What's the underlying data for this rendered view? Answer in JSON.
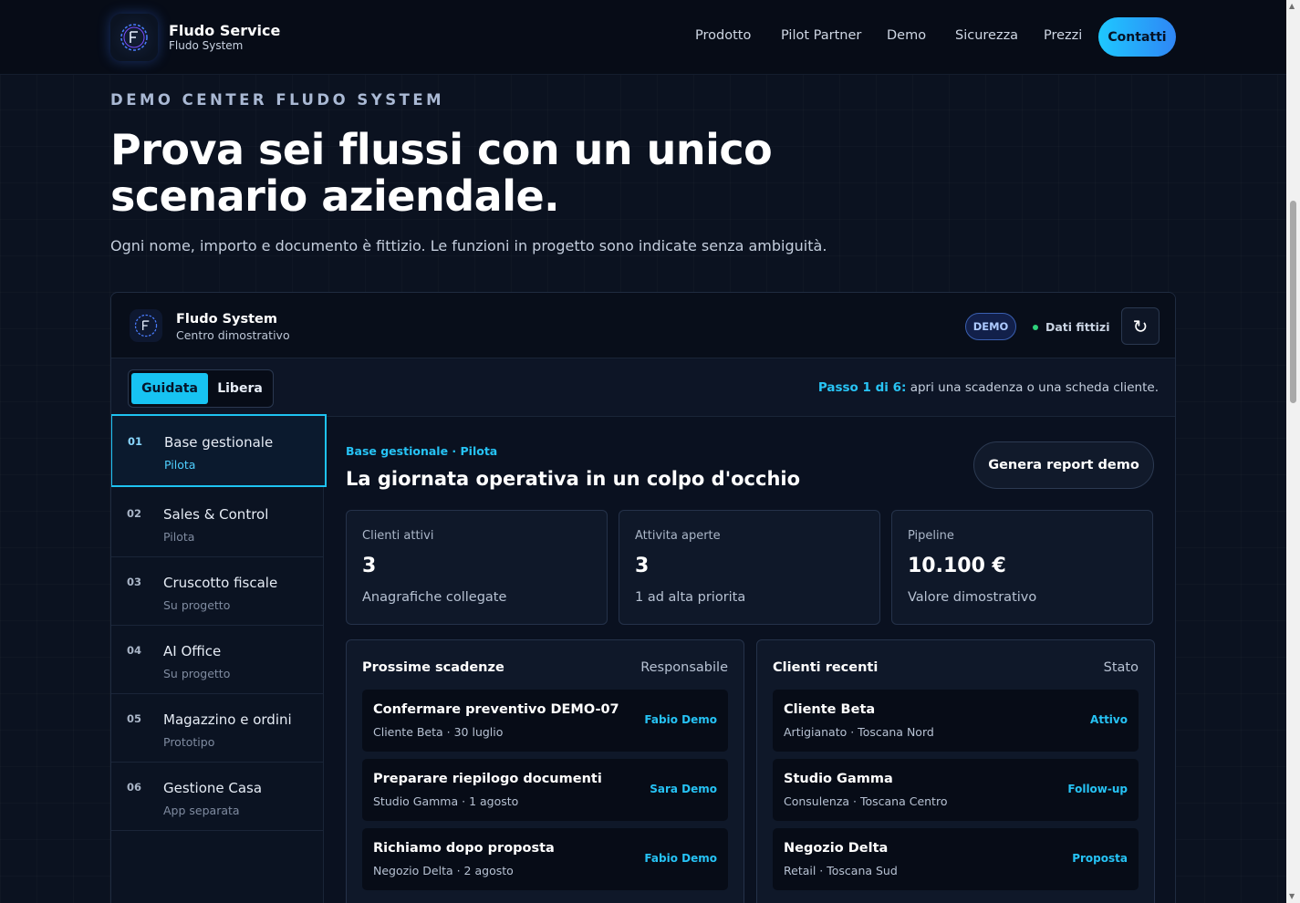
{
  "header": {
    "brand_title": "Fludo Service",
    "brand_sub": "Fludo System",
    "nav": [
      "Prodotto",
      "Pilot Partner",
      "Demo",
      "Sicurezza",
      "Prezzi"
    ],
    "cta": "Contatti"
  },
  "hero": {
    "eyebrow": "DEMO CENTER FLUDO SYSTEM",
    "title": "Prova sei flussi con un unico scenario aziendale.",
    "subtitle": "Ogni nome, importo e documento è fittizio. Le funzioni in progetto sono indicate senza ambiguità."
  },
  "panel": {
    "title": "Fludo System",
    "subtitle": "Centro dimostrativo",
    "badge": "DEMO",
    "data_status": "Dati fittizi",
    "modes": {
      "guided": "Guidata",
      "free": "Libera"
    },
    "step_label": "Passo 1 di 6:",
    "step_text": " apri una scadenza o una scheda cliente."
  },
  "sidebar": {
    "items": [
      {
        "num": "01",
        "label": "Base gestionale",
        "status": "Pilota"
      },
      {
        "num": "02",
        "label": "Sales & Control",
        "status": "Pilota"
      },
      {
        "num": "03",
        "label": "Cruscotto fiscale",
        "status": "Su progetto"
      },
      {
        "num": "04",
        "label": "AI Office",
        "status": "Su progetto"
      },
      {
        "num": "05",
        "label": "Magazzino e ordini",
        "status": "Prototipo"
      },
      {
        "num": "06",
        "label": "Gestione Casa",
        "status": "App separata"
      }
    ]
  },
  "main": {
    "tag": "Base gestionale · Pilota",
    "title": "La giornata operativa in un colpo d'occhio",
    "report_button": "Genera report demo",
    "kpis": [
      {
        "label": "Clienti attivi",
        "value": "3",
        "note": "Anagrafiche collegate"
      },
      {
        "label": "Attivita aperte",
        "value": "3",
        "note": "1 ad alta priorita"
      },
      {
        "label": "Pipeline",
        "value": "10.100 €",
        "note": "Valore dimostrativo"
      }
    ],
    "deadlines": {
      "title": "Prossime scadenze",
      "right": "Responsabile",
      "rows": [
        {
          "title": "Confermare preventivo DEMO-07",
          "sub": "Cliente Beta · 30 luglio",
          "tag": "Fabio Demo"
        },
        {
          "title": "Preparare riepilogo documenti",
          "sub": "Studio Gamma · 1 agosto",
          "tag": "Sara Demo"
        },
        {
          "title": "Richiamo dopo proposta",
          "sub": "Negozio Delta · 2 agosto",
          "tag": "Fabio Demo"
        }
      ]
    },
    "clients": {
      "title": "Clienti recenti",
      "right": "Stato",
      "rows": [
        {
          "title": "Cliente Beta",
          "sub": "Artigianato · Toscana Nord",
          "tag": "Attivo"
        },
        {
          "title": "Studio Gamma",
          "sub": "Consulenza · Toscana Centro",
          "tag": "Follow-up"
        },
        {
          "title": "Negozio Delta",
          "sub": "Retail · Toscana Sud",
          "tag": "Proposta"
        }
      ]
    }
  }
}
